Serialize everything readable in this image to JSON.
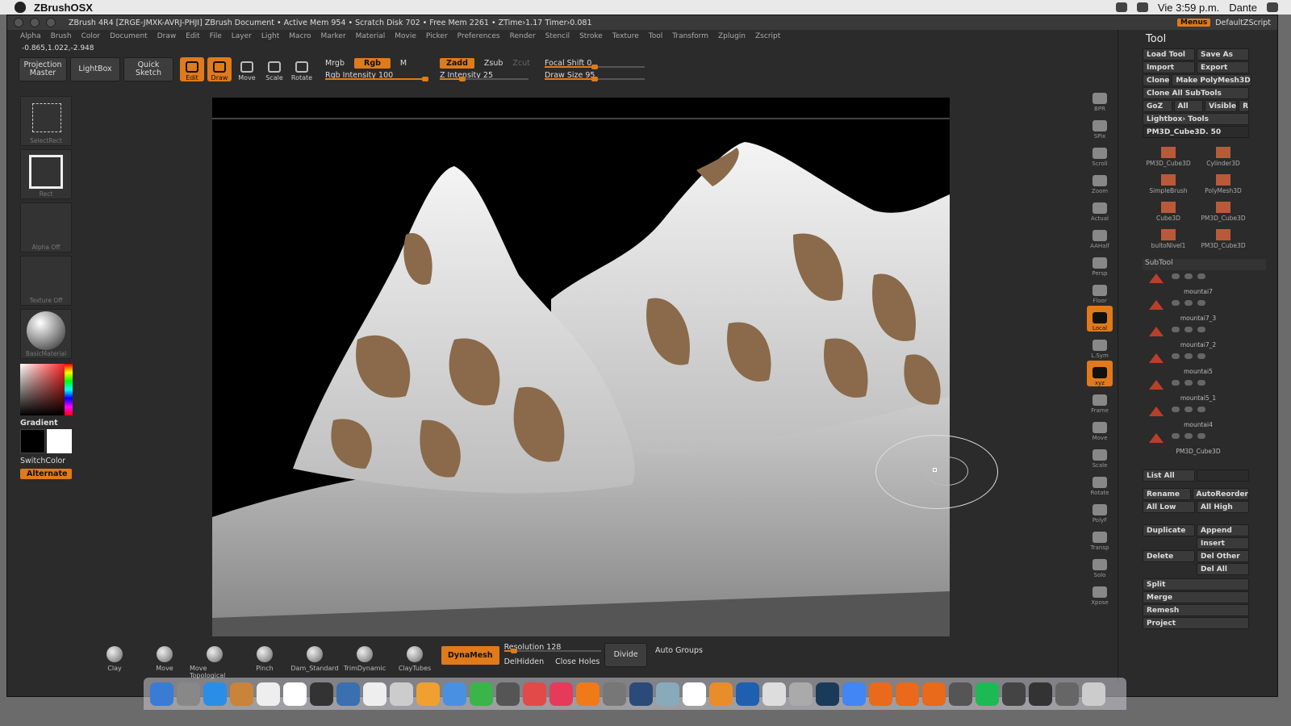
{
  "macbar": {
    "app": "ZBrushOSX",
    "clock": "Vie 3:59 p.m.",
    "user": "Dante"
  },
  "titlebar": {
    "text": "ZBrush 4R4 [ZRGE-JMXK-AVRJ-PHJI]   ZBrush Document    • Active Mem 954 • Scratch Disk 702 • Free Mem 2261 • ZTime›1.17 Timer›0.081",
    "menus": "Menus",
    "script": "DefaultZScript"
  },
  "menus": [
    "Alpha",
    "Brush",
    "Color",
    "Document",
    "Draw",
    "Edit",
    "File",
    "Layer",
    "Light",
    "Macro",
    "Marker",
    "Material",
    "Movie",
    "Picker",
    "Preferences",
    "Render",
    "Stencil",
    "Stroke",
    "Texture",
    "Tool",
    "Transform",
    "Zplugin",
    "Zscript"
  ],
  "coords": "-0.865,1.022,-2.948",
  "topshelf": {
    "projection": "Projection Master",
    "lightbox": "LightBox",
    "quicksketch": "Quick Sketch",
    "tools": [
      {
        "label": "Edit",
        "on": true
      },
      {
        "label": "Draw",
        "on": true
      },
      {
        "label": "Move",
        "on": false
      },
      {
        "label": "Scale",
        "on": false
      },
      {
        "label": "Rotate",
        "on": false
      }
    ],
    "mrgb": "Mrgb",
    "rgb": "Rgb",
    "m": "M",
    "rgb_intensity": "Rgb Intensity 100",
    "zadd": "Zadd",
    "zsub": "Zsub",
    "zcut": "Zcut",
    "z_intensity": "Z Intensity 25",
    "focal_shift": "Focal Shift 0",
    "draw_size": "Draw Size 95",
    "levels": {
      "rgb_intensity": 1.0,
      "z_intensity": 0.25,
      "focal_shift": 0.5,
      "draw_size": 0.5
    }
  },
  "leftbar": {
    "tiles": [
      "SelectRect",
      "Rect",
      "Alpha Off",
      "Texture Off",
      "BasicMaterial"
    ],
    "gradient": "Gradient",
    "switchcolor": "SwitchColor",
    "alternate": "Alternate"
  },
  "rightdock": [
    {
      "label": "BPR"
    },
    {
      "label": "SPix"
    },
    {
      "label": "Scroll"
    },
    {
      "label": "Zoom"
    },
    {
      "label": "Actual"
    },
    {
      "label": "AAHalf"
    },
    {
      "label": "Persp"
    },
    {
      "label": "Floor"
    },
    {
      "label": "Local",
      "on": true
    },
    {
      "label": "L.Sym"
    },
    {
      "label": "xyz",
      "on": true
    },
    {
      "label": "Frame"
    },
    {
      "label": "Move"
    },
    {
      "label": "Scale"
    },
    {
      "label": "Rotate"
    },
    {
      "label": "PolyF"
    },
    {
      "label": "Transp"
    },
    {
      "label": "Solo"
    },
    {
      "label": "Xpose"
    }
  ],
  "toolpanel": {
    "title": "Tool",
    "load_tool": "Load Tool",
    "save_as": "Save As",
    "import": "Import",
    "export": "Export",
    "clone": "Clone",
    "make_polymesh": "Make PolyMesh3D",
    "clone_all": "Clone All SubTools",
    "goz": "GoZ",
    "all": "All",
    "visible": "Visible",
    "r": "R",
    "lightbox_tools": "Lightbox› Tools",
    "current_tool": "PM3D_Cube3D. 50",
    "thumbs": [
      "PM3D_Cube3D",
      "Cylinder3D",
      "SimpleBrush",
      "PolyMesh3D",
      "Cube3D",
      "PM3D_Cube3D",
      "bultoNivel1",
      "PM3D_Cube3D"
    ],
    "subtool_head": "SubTool",
    "subtools": [
      "mountai7",
      "mountai7_3",
      "mountai7_2",
      "mountai5",
      "mountai5_1",
      "mountai4",
      "PM3D_Cube3D"
    ],
    "list_all": "List All",
    "rename": "Rename",
    "autoreorder": "AutoReorder",
    "all_low": "All Low",
    "all_high": "All High",
    "duplicate": "Duplicate",
    "append": "Append",
    "insert": "Insert",
    "delete": "Delete",
    "del_other": "Del Other",
    "del_all": "Del All",
    "split": "Split",
    "merge": "Merge",
    "remesh": "Remesh",
    "project": "Project"
  },
  "bottomshelf": {
    "brushes": [
      "Clay",
      "Move",
      "Move Topological",
      "Pinch",
      "Dam_Standard",
      "TrimDynamic",
      "ClayTubes"
    ],
    "dynamesh": "DynaMesh",
    "resolution": "Resolution 128",
    "delhidden": "DelHidden",
    "closeholes": "Close Holes",
    "divide": "Divide",
    "autogroups": "Auto Groups",
    "levels": {
      "resolution": 0.1
    }
  },
  "dock": {
    "count": 36
  }
}
